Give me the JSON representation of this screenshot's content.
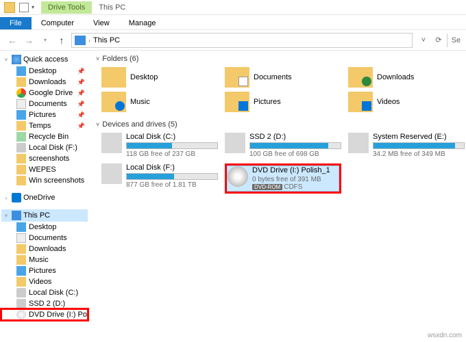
{
  "titlebar": {
    "context_tab": "Drive Tools",
    "title": "This PC"
  },
  "ribbon": {
    "tabs": [
      "File",
      "Computer",
      "View",
      "Manage"
    ]
  },
  "addressbar": {
    "location": "This PC",
    "refresh_icon": "refresh",
    "dropdown_icon": "chevron-down",
    "search_icon": "search"
  },
  "nav": {
    "quick_access": {
      "label": "Quick access",
      "items": [
        {
          "label": "Desktop",
          "pinned": true,
          "icon": "desktop"
        },
        {
          "label": "Downloads",
          "pinned": true,
          "icon": "folder"
        },
        {
          "label": "Google Drive",
          "pinned": true,
          "icon": "gdrive"
        },
        {
          "label": "Documents",
          "pinned": true,
          "icon": "doc"
        },
        {
          "label": "Pictures",
          "pinned": true,
          "icon": "pic"
        },
        {
          "label": "Temps",
          "pinned": true,
          "icon": "folder"
        },
        {
          "label": "Recycle Bin",
          "pinned": false,
          "icon": "recycle"
        },
        {
          "label": "Local Disk (F:)",
          "pinned": false,
          "icon": "disk"
        },
        {
          "label": "screenshots",
          "pinned": false,
          "icon": "folder"
        },
        {
          "label": "WEPES",
          "pinned": false,
          "icon": "folder"
        },
        {
          "label": "Win screenshots",
          "pinned": false,
          "icon": "folder"
        }
      ]
    },
    "onedrive": {
      "label": "OneDrive"
    },
    "thispc": {
      "label": "This PC",
      "items": [
        {
          "label": "Desktop",
          "icon": "desktop"
        },
        {
          "label": "Documents",
          "icon": "doc"
        },
        {
          "label": "Downloads",
          "icon": "folder"
        },
        {
          "label": "Music",
          "icon": "folder"
        },
        {
          "label": "Pictures",
          "icon": "pic"
        },
        {
          "label": "Videos",
          "icon": "folder"
        },
        {
          "label": "Local Disk (C:)",
          "icon": "disk"
        },
        {
          "label": "SSD 2 (D:)",
          "icon": "disk"
        },
        {
          "label": "DVD Drive (I:) Polish",
          "icon": "dvd",
          "highlighted": true
        }
      ]
    }
  },
  "content": {
    "folders": {
      "header": "Folders (6)",
      "items": [
        {
          "label": "Desktop"
        },
        {
          "label": "Documents"
        },
        {
          "label": "Downloads"
        },
        {
          "label": "Music"
        },
        {
          "label": "Pictures"
        },
        {
          "label": "Videos"
        }
      ]
    },
    "drives": {
      "header": "Devices and drives (5)",
      "items": [
        {
          "name": "Local Disk (C:)",
          "free": "118 GB free of 237 GB",
          "fill_pct": 50
        },
        {
          "name": "SSD 2 (D:)",
          "free": "100 GB free of 698 GB",
          "fill_pct": 86
        },
        {
          "name": "System Reserved (E:)",
          "free": "34.2 MB free of 349 MB",
          "fill_pct": 90
        },
        {
          "name": "Local Disk (F:)",
          "free": "877 GB free of 1.81 TB",
          "fill_pct": 52
        },
        {
          "name": "DVD Drive (I:) Polish_1",
          "free": "0 bytes free of 391 MB",
          "badge": "DVD-ROM",
          "fs": "CDFS",
          "selected": true,
          "highlighted": true,
          "dvd": true
        }
      ]
    }
  },
  "watermark": "wsxdn.com"
}
